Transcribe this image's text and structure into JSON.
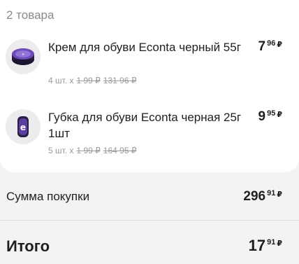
{
  "cart": {
    "count_label": "2 товара",
    "items": [
      {
        "icon": "shoe-cream-tin-icon",
        "name": "Крем для обуви Econta черный 55г",
        "quantity": "4 шт. x",
        "unit_price_old": "1 99 ₽",
        "total_old": "131 96 ₽",
        "price_int": "7",
        "price_frac": "96",
        "currency": "₽"
      },
      {
        "icon": "shoe-sponge-icon",
        "name": "Губка для обуви Econta черная 25г 1шт",
        "quantity": "5 шт. x",
        "unit_price_old": "1 99 ₽",
        "total_old": "164 95 ₽",
        "price_int": "9",
        "price_frac": "95",
        "currency": "₽"
      }
    ]
  },
  "summary": {
    "purchase_label": "Сумма покупки",
    "purchase_int": "296",
    "purchase_frac": "91",
    "total_label": "Итого",
    "total_int": "17",
    "total_frac": "91",
    "currency": "₽"
  },
  "colors": {
    "background": "#f3f3f5",
    "card": "#ffffff",
    "muted_text": "#8a8a8a",
    "product_purple": "#5b3fa0"
  }
}
